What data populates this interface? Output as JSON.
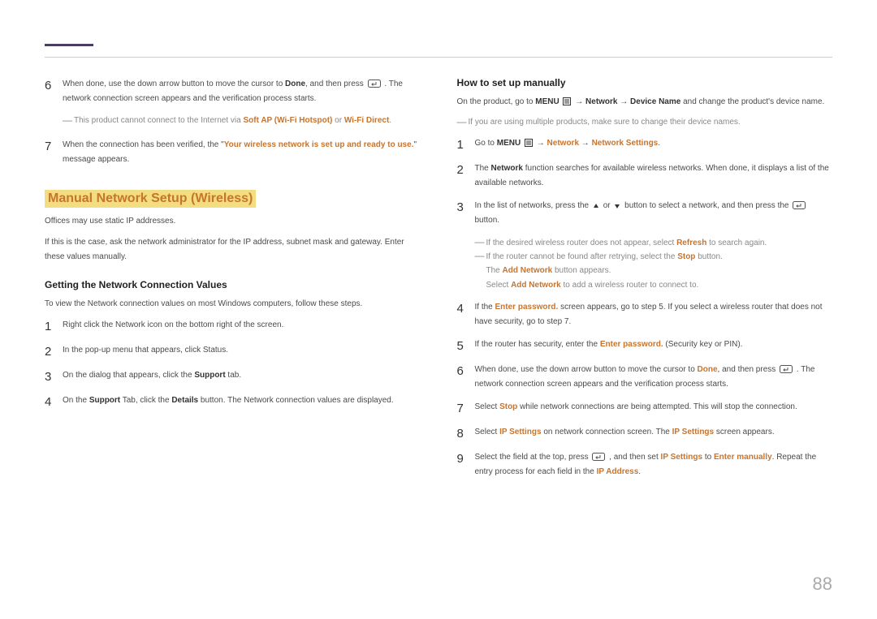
{
  "pageNumber": "88",
  "left": {
    "step6": {
      "text1": "When done, use the down arrow button to move the cursor to ",
      "done": "Done",
      "text2": ", and then press ",
      "text3": ". The network connection screen appears and the verification process starts."
    },
    "note1": {
      "t1": "This product cannot connect to the Internet via ",
      "softap": "Soft AP (Wi-Fi Hotspot)",
      "or": " or ",
      "wifidirect": "Wi-Fi Direct",
      "dot": "."
    },
    "step7": {
      "t1": "When the connection has been verified, the \"",
      "msg": "Your wireless network is set up and ready to use.",
      "t2": "\" message appears."
    },
    "h_manual": "Manual Network Setup (Wireless)",
    "p1": "Offices may use static IP addresses.",
    "p2": "If this is the case, ask the network administrator for the IP address, subnet mask and gateway. Enter these values manually.",
    "h_getting": "Getting the Network Connection Values",
    "p3": "To view the Network connection values on most Windows computers, follow these steps.",
    "g1": "Right click the Network icon on the bottom right of the screen.",
    "g2": "In the pop-up menu that appears, click Status.",
    "g3": {
      "t1": "On the dialog that appears, click the ",
      "support": "Support",
      "t2": " tab."
    },
    "g4": {
      "t1": "On the ",
      "support": "Support",
      "t2": " Tab, click the ",
      "details": "Details",
      "t3": " button. The Network connection values are displayed."
    }
  },
  "right": {
    "h_howto": "How to set up manually",
    "intro": {
      "t1": "On the product, go to ",
      "menu": "MENU",
      "arrow": " → ",
      "network": "Network",
      "devicename": "Device Name",
      "t2": " and change the product's device name."
    },
    "note_multi": "If you are using multiple products, make sure to change their device names.",
    "s1": {
      "t1": "Go to ",
      "menu": "MENU",
      "arrow": " → ",
      "network": "Network",
      "ns": "Network Settings",
      "dot": "."
    },
    "s2": {
      "t1": "The ",
      "network": "Network",
      "t2": " function searches for available wireless networks. When done, it displays a list of the available networks."
    },
    "s3": {
      "t1": "In the list of networks, press the ",
      "or": " or ",
      "t2": " button to select a network, and then press the ",
      "t3": " button."
    },
    "nested": {
      "n1a": "If the desired wireless router does not appear, select ",
      "refresh": "Refresh",
      "n1b": " to search again.",
      "n2a": "If the router cannot be found after retrying, select the ",
      "stop": "Stop",
      "n2b": " button.",
      "n3a": "The ",
      "addnet": "Add Network",
      "n3b": " button appears.",
      "n4a": "Select ",
      "n4b": " to add a wireless router to connect to."
    },
    "s4": {
      "t1": "If the ",
      "ep": "Enter password.",
      "t2": " screen appears, go to step 5. If you select a wireless router that does not have security, go to step 7."
    },
    "s5": {
      "t1": "If the router has security, enter the ",
      "ep": "Enter password.",
      "t2": " (Security key or PIN)."
    },
    "s6": {
      "t1": "When done, use the down arrow button to move the cursor to ",
      "done": "Done",
      "t2": ", and then press ",
      "t3": ". The network connection screen appears and the verification process starts."
    },
    "s7": {
      "t1": "Select ",
      "stop": "Stop",
      "t2": " while network connections are being attempted. This will stop the connection."
    },
    "s8": {
      "t1": "Select ",
      "ips": "IP Settings",
      "t2": " on network connection screen. The ",
      "t3": " screen appears."
    },
    "s9": {
      "t1": "Select the field at the top, press ",
      "t2": ", and then set ",
      "ips": "IP Settings",
      "to": " to ",
      "em": "Enter manually",
      "t3": ". Repeat the entry process for each field in the ",
      "ipa": "IP Address",
      "dot": "."
    }
  }
}
